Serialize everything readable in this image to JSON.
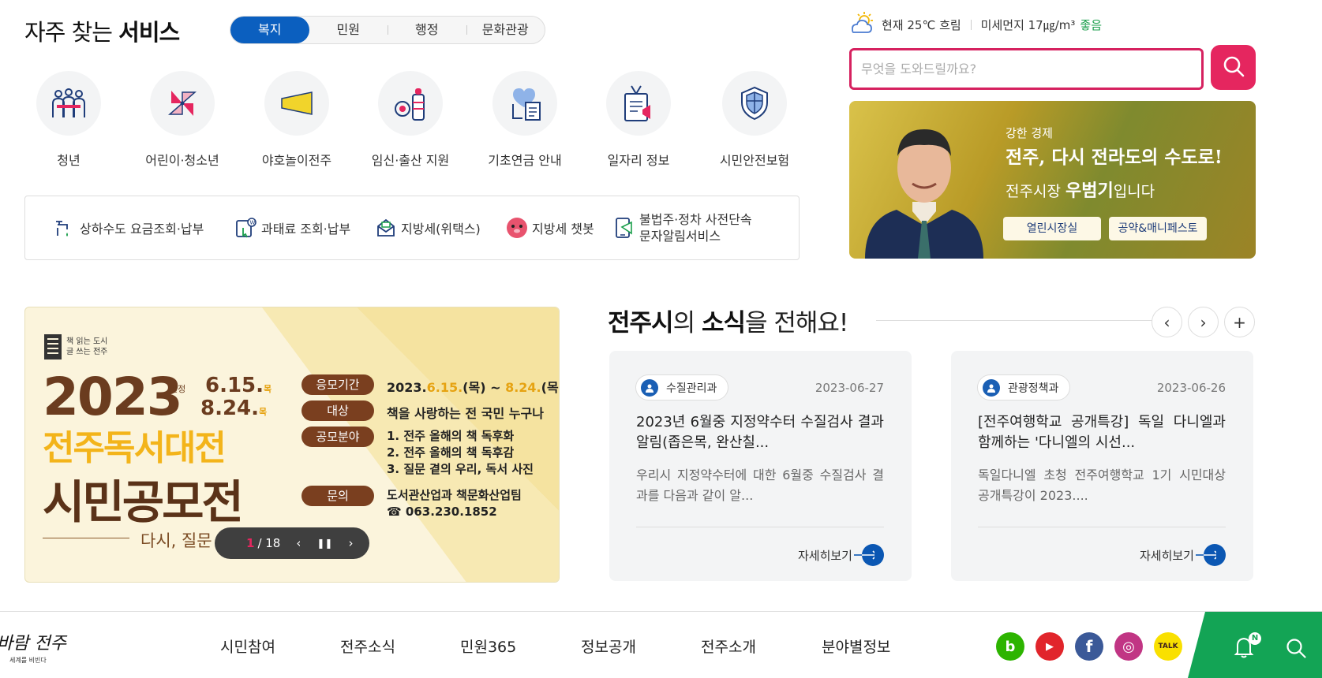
{
  "services": {
    "title_plain": "자주 찾는",
    "title_bold": "서비스",
    "tabs": [
      {
        "label": "복지",
        "active": true
      },
      {
        "label": "민원",
        "active": false
      },
      {
        "label": "행정",
        "active": false
      },
      {
        "label": "문화관광",
        "active": false
      }
    ],
    "items": [
      {
        "label": "청년",
        "icon": "youth-people-icon"
      },
      {
        "label": "어린이·청소년",
        "icon": "pinwheel-icon"
      },
      {
        "label": "야호놀이전주",
        "icon": "megaphone-horn-icon"
      },
      {
        "label": "임신·출산 지원",
        "icon": "baby-bottle-icon"
      },
      {
        "label": "기초연금 안내",
        "icon": "heart-document-icon"
      },
      {
        "label": "일자리 정보",
        "icon": "job-badge-icon"
      },
      {
        "label": "시민안전보험",
        "icon": "shield-cross-icon"
      }
    ],
    "quick_links": [
      {
        "label": "상하수도 요금조회·납부",
        "icon": "water-tap-icon"
      },
      {
        "label": "과태료 조회·납부",
        "icon": "fine-payment-icon"
      },
      {
        "label": "지방세(위택스)",
        "icon": "tax-envelope-icon"
      },
      {
        "label": "지방세 챗봇",
        "icon": "chatbot-face-icon"
      },
      {
        "label_line1": "불법주·정차 사전단속",
        "label_line2": "문자알림서비스",
        "icon": "parking-sms-icon"
      }
    ]
  },
  "weather": {
    "current": "현재 25℃ 흐림",
    "dust": "미세먼지 17㎍/m³",
    "dust_status": "좋음",
    "icon": "cloudy-sun-icon"
  },
  "search": {
    "placeholder": "무엇을 도와드릴까요?",
    "button_icon": "search-icon"
  },
  "mayor": {
    "line1": "강한 경제",
    "line2": "전주, 다시 전라도의 수도로!",
    "line3_prefix": "전주시장",
    "line3_name": "우범기",
    "line3_suffix": "입니다",
    "button1": "열린시장실",
    "button2": "공약&매니페스토"
  },
  "promo": {
    "logo_text1": "책 읽는 도시",
    "logo_text2": "글 쓰는 전주",
    "year": "2023",
    "period_label": "일정",
    "date1": "6.15.",
    "date1_day": "목",
    "date2": "8.24.",
    "date2_day": "목",
    "title1": "전주독서대전",
    "title2": "시민공모전",
    "subtitle": "다시, 질문 곁으로",
    "rows": [
      {
        "tag": "응모기간",
        "value_pre": "2023.",
        "value_d1": "6.15.",
        "value_mid": "(목) ~ ",
        "value_d2": "8.24.",
        "value_post": "(목)"
      },
      {
        "tag": "대상",
        "value": "책을 사랑하는 전 국민 누구나"
      },
      {
        "tag": "공모분야",
        "lines": [
          "1. 전주 올해의 책 독후화",
          "2. 전주 올해의 책 독후감",
          "3. 질문 곁의 우리, 독서 사진"
        ]
      },
      {
        "tag": "문의",
        "lines": [
          "도서관산업과 책문화산업팀",
          "☎ 063.230.1852"
        ]
      }
    ],
    "slider": {
      "current": "1",
      "total": "/ 18"
    }
  },
  "news": {
    "title_a": "전주시",
    "title_b": "의 ",
    "title_c": "소식",
    "title_d": "을 전해요!",
    "cards": [
      {
        "dept": "수질관리과",
        "date": "2023-06-27",
        "headline": "2023년 6월중 지정약수터 수질검사 결과 알림(좁은목, 완산칠...",
        "summary": "우리시 지정약수터에 대한 6월중 수질검사 결과를 다음과 같이 알...",
        "more": "자세히보기"
      },
      {
        "dept": "관광정책과",
        "date": "2023-06-26",
        "headline": "[전주여행학교 공개특강] 독일 다니엘과 함께하는 '다니엘의 시선...",
        "summary": "독일다니엘 초청 전주여행학교 1기 시민대상 공개특강이 2023....",
        "more": "자세히보기"
      }
    ]
  },
  "footer": {
    "logo_script": "바람 전주",
    "logo_sub": "세계를 비빈다",
    "nav": [
      "시민참여",
      "전주소식",
      "민원365",
      "정보공개",
      "전주소개",
      "분야별정보"
    ],
    "sns": [
      {
        "name": "blog-icon",
        "glyph": "b",
        "color": "#2db400"
      },
      {
        "name": "youtube-icon",
        "glyph": "▶",
        "color": "#e1252b"
      },
      {
        "name": "facebook-icon",
        "glyph": "f",
        "color": "#3b5998"
      },
      {
        "name": "instagram-icon",
        "glyph": "◎",
        "color": "#c13584"
      },
      {
        "name": "kakaotalk-icon",
        "glyph": "TALK",
        "color": "#f9e000"
      }
    ],
    "bell_badge": "N",
    "accent": "#13a455"
  }
}
